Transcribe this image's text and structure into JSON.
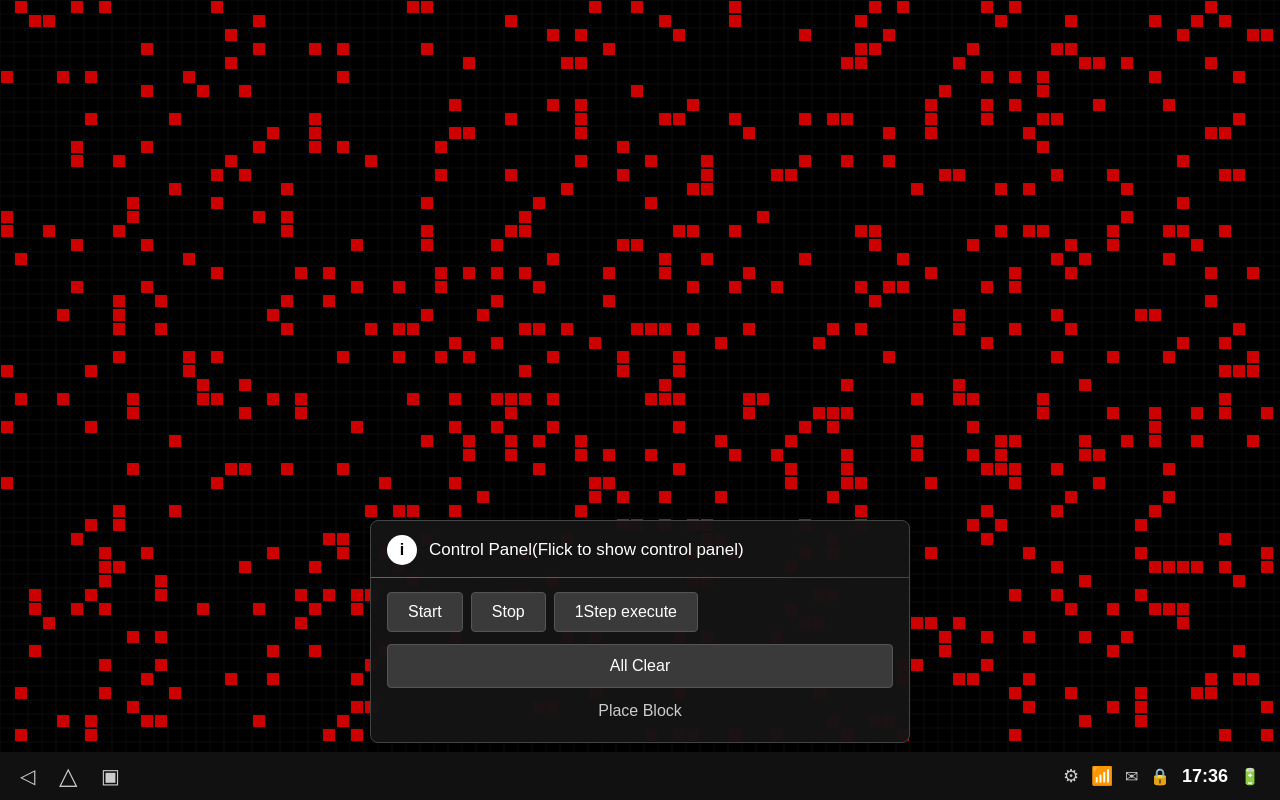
{
  "grid": {
    "cell_size": 14,
    "cols": 92,
    "rows": 54,
    "background": "#000000",
    "grid_color": "#222222",
    "cell_color": "#cc0000"
  },
  "control_panel": {
    "title": "Control Panel(Flick to show control panel)",
    "info_icon": "i",
    "buttons": {
      "start": "Start",
      "stop": "Stop",
      "step": "1Step execute",
      "all_clear": "All Clear",
      "place_block": "Place Block"
    }
  },
  "status_bar": {
    "time": "17:36",
    "nav": {
      "back": "◁",
      "home": "△",
      "recents": "□"
    }
  }
}
